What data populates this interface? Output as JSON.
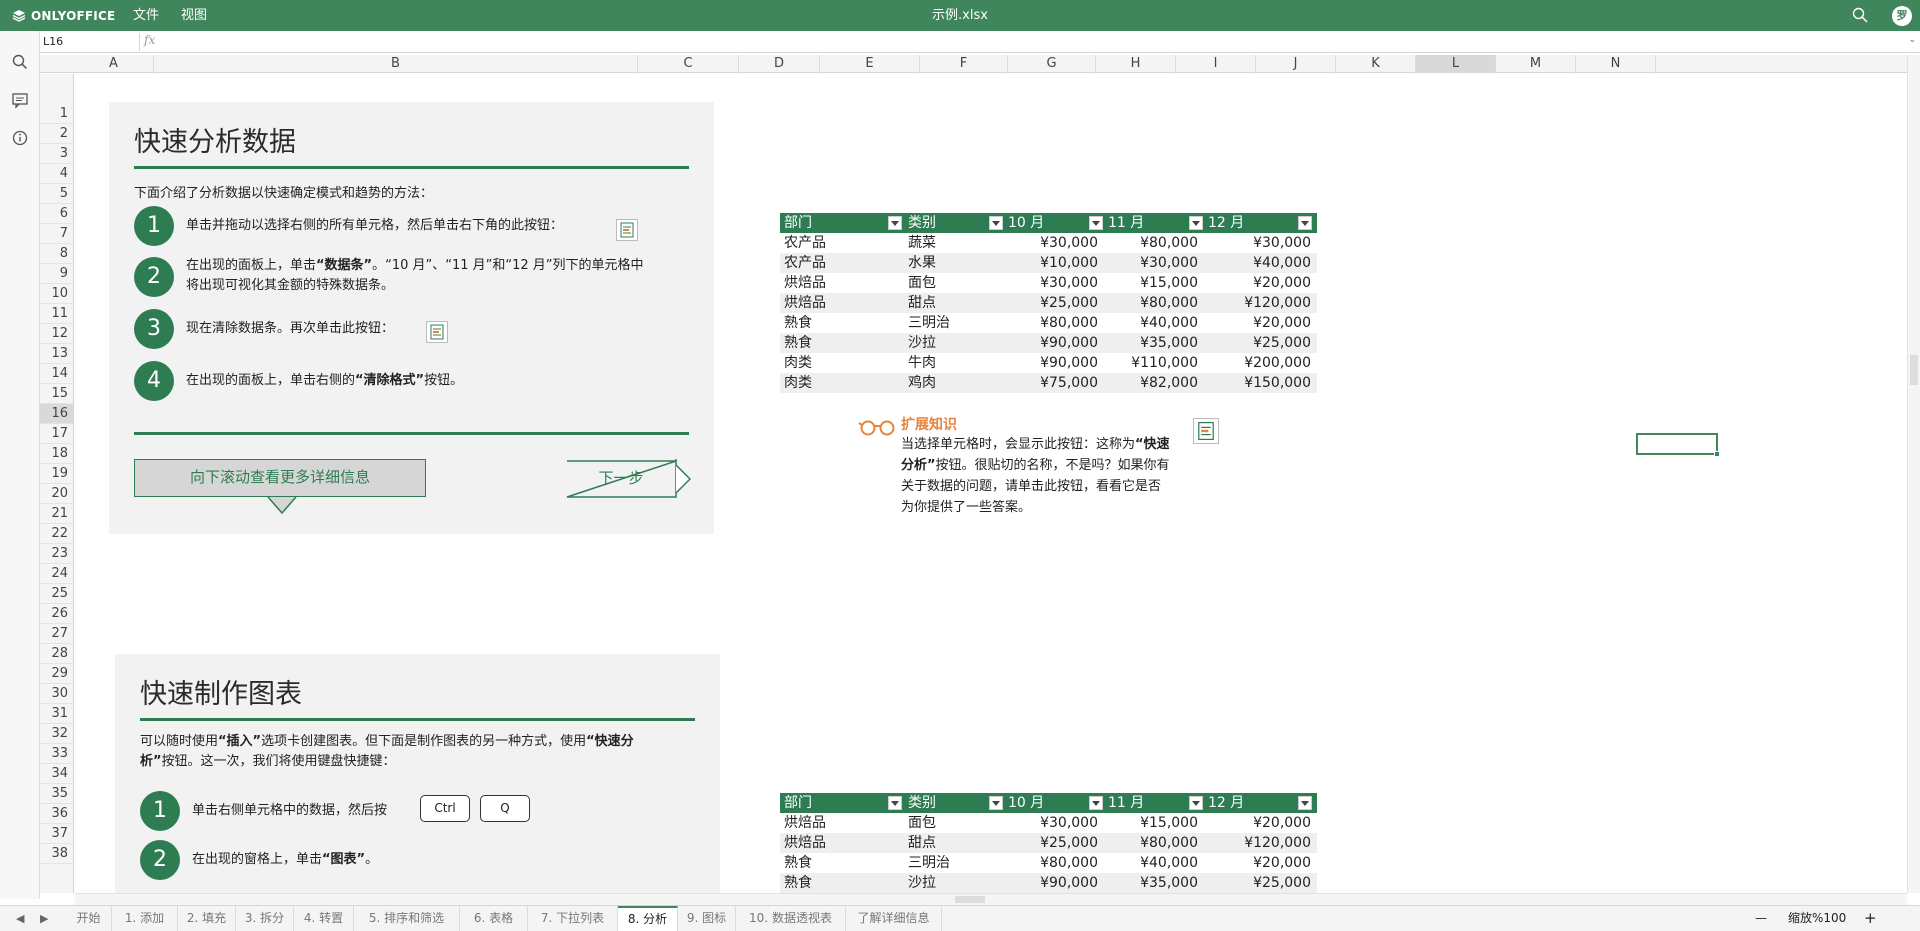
{
  "app": {
    "name": "ONLYOFFICE",
    "doc_title": "示例.xlsx",
    "user_initial": "罗"
  },
  "menu": {
    "file": "文件",
    "view": "视图"
  },
  "formula_bar": {
    "cell_ref": "L16",
    "fx": "fx",
    "value": ""
  },
  "columns": [
    "A",
    "B",
    "C",
    "D",
    "E",
    "F",
    "G",
    "H",
    "I",
    "J",
    "K",
    "L",
    "M",
    "N"
  ],
  "rows": [
    "1",
    "2",
    "3",
    "4",
    "5",
    "6",
    "7",
    "8",
    "9",
    "10",
    "11",
    "12",
    "13",
    "14",
    "15",
    "16",
    "17",
    "18",
    "19",
    "20",
    "21",
    "22",
    "23",
    "24",
    "25",
    "26",
    "27",
    "28",
    "29",
    "30",
    "31",
    "32",
    "33",
    "34",
    "35",
    "36",
    "37",
    "38"
  ],
  "selected": {
    "column": "L",
    "row": "16"
  },
  "panel1": {
    "title": "快速分析数据",
    "intro": "下面介绍了分析数据以快速确定模式和趋势的方法：",
    "steps": [
      {
        "num": "1",
        "text": "单击并拖动以选择右侧的所有单元格，然后单击右下角的此按钮："
      },
      {
        "num": "2",
        "text_a": "在出现的面板上，单击",
        "text_b": "“数据条”",
        "text_c": "。“10 月”、“11 月”和“12 月”列下的单元格中",
        "text_d": "将出现可视化其金额的特殊数据条。"
      },
      {
        "num": "3",
        "text": "现在清除数据条。再次单击此按钮："
      },
      {
        "num": "4",
        "text_a": "在出现的面板上，单击右侧的",
        "text_b": "“清除格式”",
        "text_c": "按钮。"
      }
    ],
    "scroll_button": "向下滚动查看更多详细信息",
    "next_button": "下一步"
  },
  "panel2": {
    "title": "快速制作图表",
    "intro_a": "可以随时使用",
    "intro_b": "“插入”",
    "intro_c": "选项卡创建图表。但下面是制作图表的另一种方式，使用",
    "intro_d": "“快速分",
    "intro_e": "析”",
    "intro_f": "按钮。这一次，我们将使用键盘快捷键：",
    "steps": [
      {
        "num": "1",
        "text": "单击右侧单元格中的数据，然后按"
      },
      {
        "num": "2",
        "text_a": "在出现的窗格上，单击",
        "text_b": "“图表”",
        "text_c": "。"
      }
    ],
    "keys": [
      "Ctrl",
      "Q"
    ]
  },
  "table1": {
    "headers": [
      "部门",
      "类别",
      "10 月",
      "11 月",
      "12 月"
    ],
    "rows": [
      [
        "农产品",
        "蔬菜",
        "¥30,000",
        "¥80,000",
        "¥30,000"
      ],
      [
        "农产品",
        "水果",
        "¥10,000",
        "¥30,000",
        "¥40,000"
      ],
      [
        "烘焙品",
        "面包",
        "¥30,000",
        "¥15,000",
        "¥20,000"
      ],
      [
        "烘焙品",
        "甜点",
        "¥25,000",
        "¥80,000",
        "¥120,000"
      ],
      [
        "熟食",
        "三明治",
        "¥80,000",
        "¥40,000",
        "¥20,000"
      ],
      [
        "熟食",
        "沙拉",
        "¥90,000",
        "¥35,000",
        "¥25,000"
      ],
      [
        "肉类",
        "牛肉",
        "¥90,000",
        "¥110,000",
        "¥200,000"
      ],
      [
        "肉类",
        "鸡肉",
        "¥75,000",
        "¥82,000",
        "¥150,000"
      ]
    ]
  },
  "table2": {
    "headers": [
      "部门",
      "类别",
      "10 月",
      "11 月",
      "12 月"
    ],
    "rows": [
      [
        "烘焙品",
        "面包",
        "¥30,000",
        "¥15,000",
        "¥20,000"
      ],
      [
        "烘焙品",
        "甜点",
        "¥25,000",
        "¥80,000",
        "¥120,000"
      ],
      [
        "熟食",
        "三明治",
        "¥80,000",
        "¥40,000",
        "¥20,000"
      ],
      [
        "熟食",
        "沙拉",
        "¥90,000",
        "¥35,000",
        "¥25,000"
      ]
    ]
  },
  "tip": {
    "title": "扩展知识",
    "line1_a": "当选择单元格时，会显示此按钮：这称为",
    "line1_b": "“快速",
    "line2_a": "分析”",
    "line2_b": "按钮。很贴切的名称，不是吗？如果你有",
    "line3": "关于数据的问题，请单击此按钮，看看它是否",
    "line4": "为你提供了一些答案。"
  },
  "sheet_tabs": [
    "开始",
    "1. 添加",
    "2. 填充",
    "3. 拆分",
    "4. 转置",
    "5. 排序和筛选",
    "6. 表格",
    "7. 下拉列表",
    "8. 分析",
    "9. 图标",
    "10. 数据透视表",
    "了解详细信息"
  ],
  "active_tab": "8. 分析",
  "zoom": {
    "label": "缩放%100",
    "minus": "—",
    "plus": "+"
  },
  "colors": {
    "brand": "#40865c",
    "accent": "#2e7d52",
    "tip": "#e9833a"
  }
}
